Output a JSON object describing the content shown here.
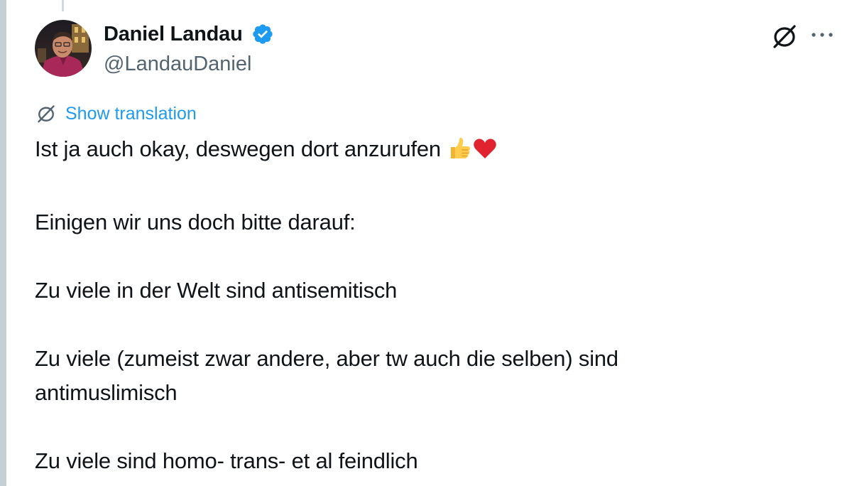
{
  "tweet": {
    "author_name": "Daniel Landau",
    "author_handle": "@LandauDaniel",
    "translate_label": "Show translation",
    "paragraphs": [
      {
        "text": "Ist ja auch okay, deswegen dort anzurufen",
        "emojis": [
          "thumbs-up-emoji",
          "red-heart-emoji"
        ]
      },
      {
        "text": "Einigen wir uns doch bitte darauf:"
      },
      {
        "text": "Zu viele in der Welt sind antisemitisch"
      },
      {
        "lines": [
          "Zu viele (zumeist zwar andere, aber tw auch die selben) sind",
          "antimuslimisch"
        ]
      },
      {
        "text": "Zu viele sind homo- trans- et al feindlich"
      }
    ]
  },
  "icons": {
    "verified": "verified-badge-icon",
    "grok": "grok-icon",
    "more": "more-options-icon",
    "translate": "translate-icon"
  },
  "colors": {
    "accent": "#1d9bf0",
    "secondary_text": "#536471",
    "primary_text": "#0f1419"
  }
}
